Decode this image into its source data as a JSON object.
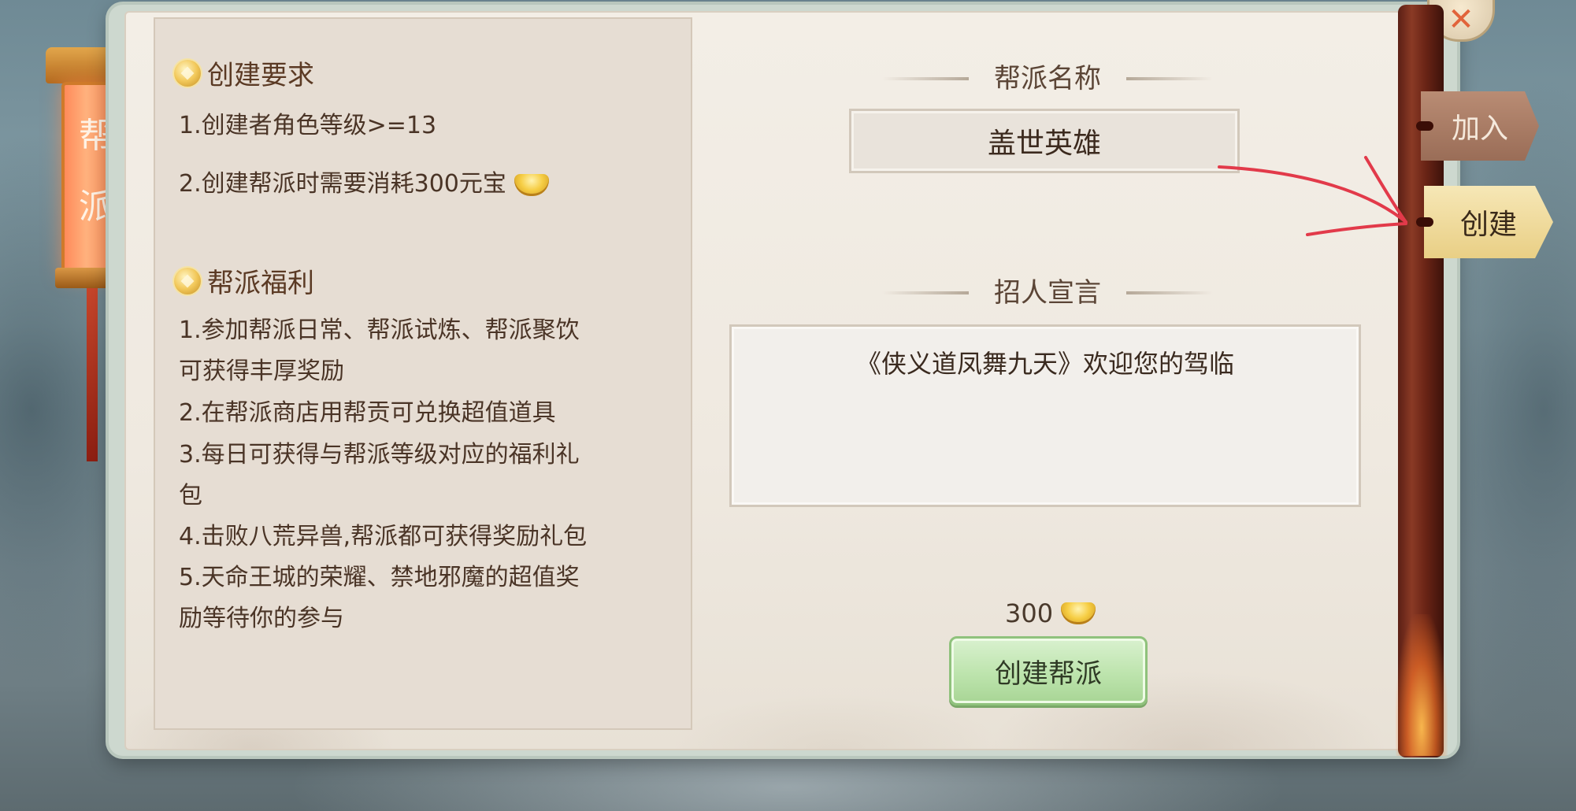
{
  "lantern": {
    "char1": "帮",
    "char2": "派"
  },
  "left": {
    "requirements_title": "创建要求",
    "requirements": [
      "1.创建者角色等级>=13",
      "2.创建帮派时需要消耗300元宝"
    ],
    "benefits_title": "帮派福利",
    "benefits_lines": [
      "1.参加帮派日常、帮派试炼、帮派聚饮",
      "可获得丰厚奖励",
      "2.在帮派商店用帮贡可兑换超值道具",
      "3.每日可获得与帮派等级对应的福利礼",
      "包",
      "4.击败八荒异兽,帮派都可获得奖励礼包",
      "5.天命王城的荣耀、禁地邪魔的超值奖",
      "励等待你的参与"
    ]
  },
  "right": {
    "name_label": "帮派名称",
    "name_value": "盖世英雄",
    "declaration_label": "招人宣言",
    "declaration_text": "《侠义道凤舞九天》欢迎您的驾临",
    "cost": "300",
    "create_button": "创建帮派"
  },
  "tabs": {
    "join": "加入",
    "create": "创建"
  },
  "colors": {
    "accent_green": "#bde4ad",
    "annotation_red": "#e23a4a",
    "tab_active": "#e9cf85"
  }
}
